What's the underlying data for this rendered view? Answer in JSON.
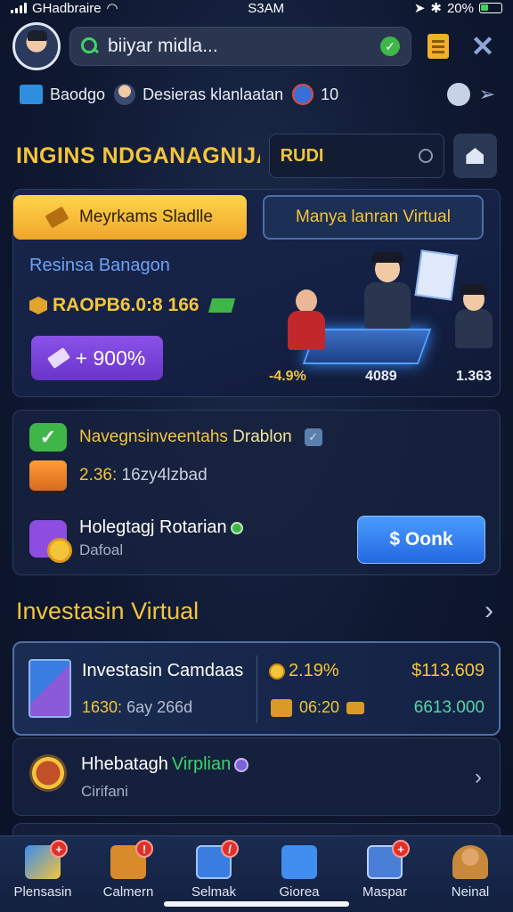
{
  "status_bar": {
    "carrier": "GHadbraire",
    "time": "S3AM",
    "battery": "20%"
  },
  "top_bar": {
    "search_value": "biiyar midla..."
  },
  "info_bar": {
    "item1_label": "Baodgo",
    "item2_label": "Desieras klanlaatan",
    "count": "10"
  },
  "section_header": {
    "title": "INGINS NDGANAGNIJAA",
    "search_value": "RUDI"
  },
  "hero": {
    "tab_active": "Meyrkams Sladlle",
    "tab_inactive": "Manya lanran Virtual",
    "label": "Resinsa Banagon",
    "value": "RAOPB6.0:8 166",
    "percent_button": "+ 900%",
    "stats": [
      "-4.9%",
      "4089",
      "1.363"
    ]
  },
  "card_rows": {
    "row1_text": "Navegnsinveentahs",
    "row1_highlight": "Drablon",
    "row2_value": "2.36:",
    "row2_text": "16zy4lzbad",
    "row3_title": "Holegtagj Rotarian",
    "row3_sub": "Dafoal",
    "action_button": "$ Oonk"
  },
  "investments": {
    "section_title": "Investasin Virtual",
    "item1": {
      "title": "Investasin Camdaas",
      "sub_value": "1630:",
      "sub_text": "6ay 266d",
      "pct": "2.19%",
      "time": "06:20",
      "amount": "$113.609",
      "amount2": "6613.000"
    },
    "item2": {
      "title": "Hhebatagh",
      "title_highlight": "Virplian",
      "sub": "Cirifani"
    }
  },
  "bottom_nav": [
    {
      "label": "Plensasin",
      "badge": "+"
    },
    {
      "label": "Calmern",
      "badge": "!"
    },
    {
      "label": "Selmak",
      "badge": "/"
    },
    {
      "label": "Giorea",
      "badge": ""
    },
    {
      "label": "Maspar",
      "badge": "+"
    },
    {
      "label": "Neinal",
      "badge": ""
    }
  ],
  "colors": {
    "accent_gold": "#f4c53a",
    "accent_blue": "#2467e0",
    "background": "#0e1830",
    "positive_green": "#3fb648"
  }
}
